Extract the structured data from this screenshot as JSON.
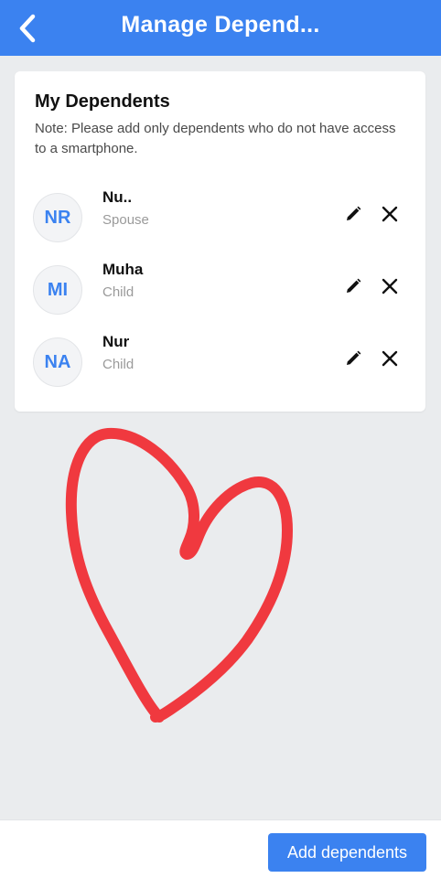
{
  "header": {
    "title": "Manage Depend...",
    "back_icon": "chevron-left-icon",
    "background": "#3b82f0"
  },
  "card": {
    "title": "My Dependents",
    "note": "Note: Please add only dependents who do not have access to a smartphone."
  },
  "dependents": [
    {
      "initials": "NR",
      "name": "Nu..",
      "relation": "Spouse"
    },
    {
      "initials": "MI",
      "name": "Muha",
      "relation": "Child"
    },
    {
      "initials": "NA",
      "name": "Nur",
      "relation": "Child"
    }
  ],
  "footer": {
    "add_label": "Add dependents"
  },
  "colors": {
    "accent": "#3b82f0",
    "heart": "#f0393f"
  }
}
